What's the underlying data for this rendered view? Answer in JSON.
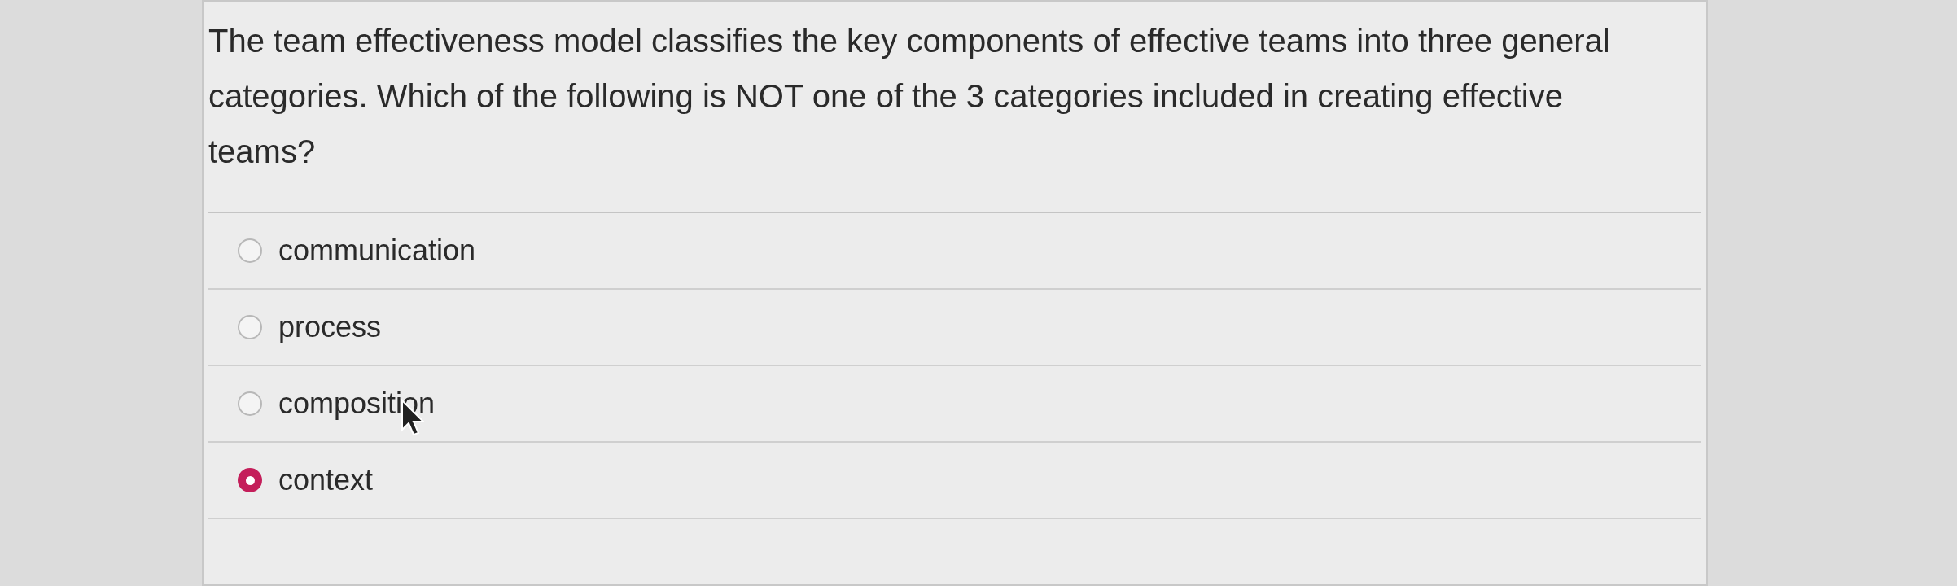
{
  "question": "The team effectiveness model classifies the key components of effective teams into three general categories. Which of the following is NOT one of the 3 categories included in creating effective teams?",
  "options": [
    {
      "label": "communication",
      "selected": false
    },
    {
      "label": "process",
      "selected": false
    },
    {
      "label": "composition",
      "selected": false
    },
    {
      "label": "context",
      "selected": true
    }
  ]
}
